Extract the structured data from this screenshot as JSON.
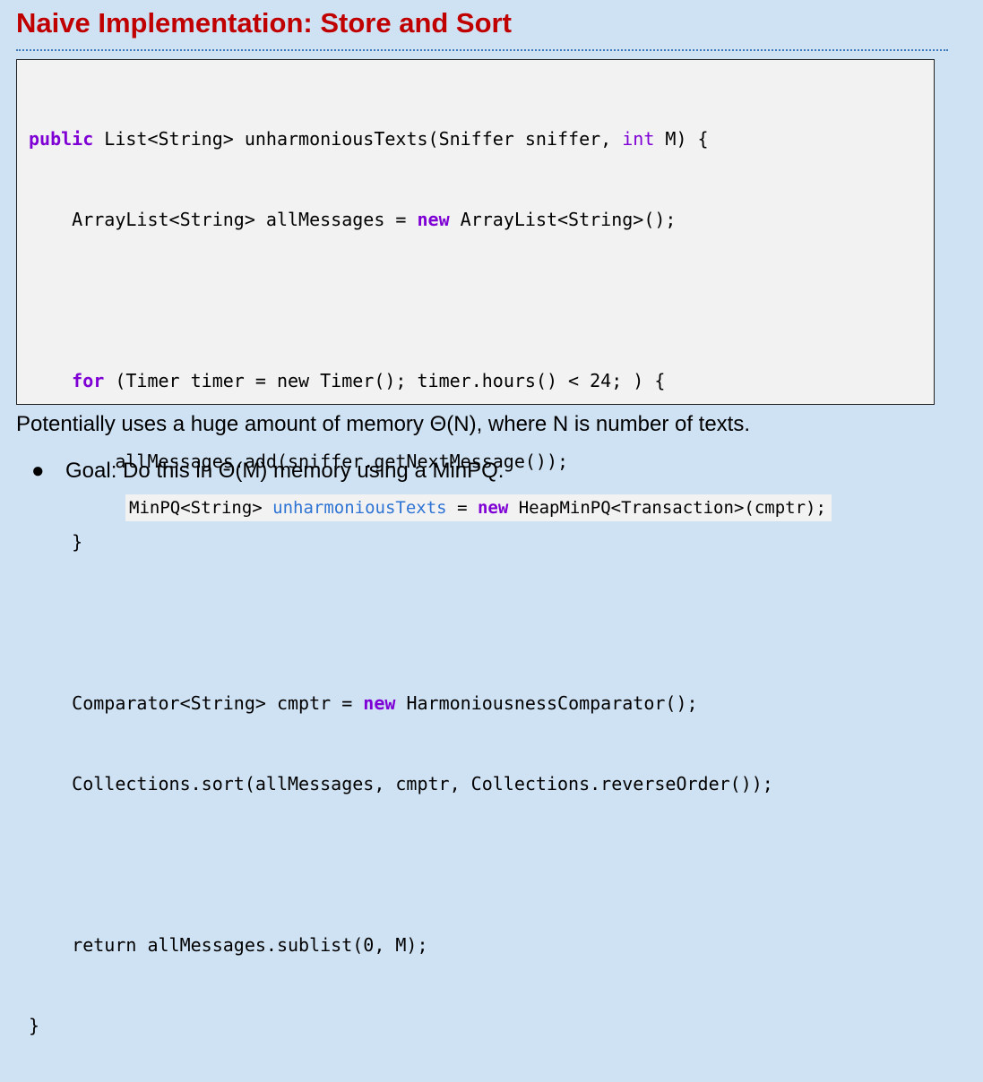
{
  "title": "Naive Implementation: Store and Sort",
  "code": {
    "l1": {
      "kw": "public",
      "rest_a": " List<String> unharmoniousTexts(Sniffer sniffer, ",
      "kw2": "int",
      "rest_b": " M) {"
    },
    "l2": {
      "rest_a": "    ArrayList<String> allMessages = ",
      "kw": "new",
      "rest_b": " ArrayList<String>();"
    },
    "l4": {
      "indent": "    ",
      "kw": "for",
      "rest": " (Timer timer = new Timer(); timer.hours() < 24; ) {"
    },
    "l5": "        allMessages.add(sniffer.getNextMessage());",
    "l6": "    }",
    "l8": {
      "rest_a": "    Comparator<String> cmptr = ",
      "kw": "new",
      "rest_b": " HarmoniousnessComparator();"
    },
    "l9": "    Collections.sort(allMessages, cmptr, Collections.reverseOrder());",
    "l11": "    return allMessages.sublist(0, M);",
    "l12": "}"
  },
  "body_text": "Potentially uses a huge amount of memory Θ(N), where N is number of texts.",
  "bullet": {
    "symbol": "●",
    "text": "Goal: Do this in Θ(M) memory using a MinPQ."
  },
  "snippet": {
    "a": "MinPQ<String> ",
    "var": "unharmoniousTexts",
    "b": " = ",
    "kw": "new",
    "c": " HeapMinPQ<Transaction>(cmptr);"
  }
}
